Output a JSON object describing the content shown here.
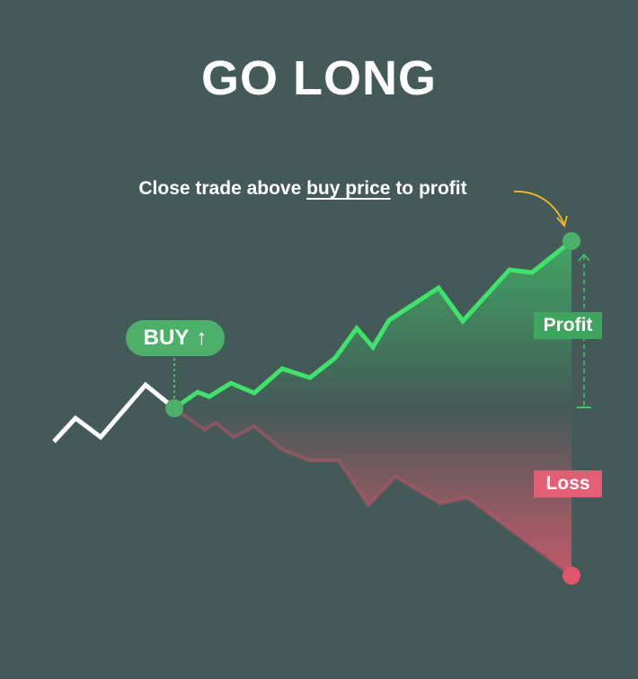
{
  "title": "GO LONG",
  "subtitle": {
    "before": "Close trade above ",
    "underlined": "buy price",
    "after": " to profit"
  },
  "buy_badge": {
    "label": "BUY",
    "arrow": "↑"
  },
  "profit_label": "Profit",
  "loss_label": "Loss",
  "colors": {
    "background": "#445a58",
    "profit": "#3fe26b",
    "profit_badge": "#3ea55f",
    "buy_badge": "#4caf6a",
    "loss": "#d9596e",
    "loss_badge": "#e05f73",
    "history_line": "#ffffff",
    "arrow_annotation": "#f2b92c"
  }
}
